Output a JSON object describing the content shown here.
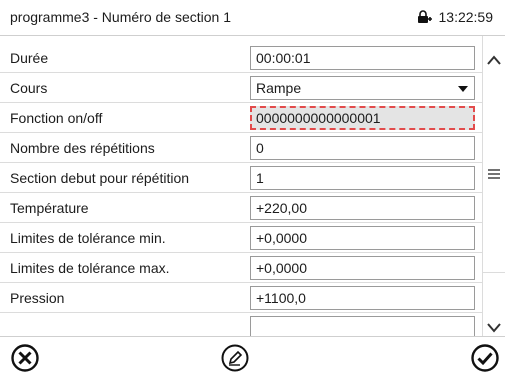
{
  "header": {
    "title": "programme3 - Numéro de section 1",
    "time": "13:22:59"
  },
  "rows": [
    {
      "label": "Durée",
      "value": "00:00:01"
    },
    {
      "label": "Cours",
      "value": "Rampe"
    },
    {
      "label": "Fonction on/off",
      "value": "0000000000000001"
    },
    {
      "label": "Nombre des répétitions",
      "value": "0"
    },
    {
      "label": "Section debut pour répétition",
      "value": "1"
    },
    {
      "label": "Température",
      "value": "+220,00"
    },
    {
      "label": "Limites de tolérance min.",
      "value": "+0,0000"
    },
    {
      "label": "Limites de tolérance max.",
      "value": "+0,0000"
    },
    {
      "label": "Pression",
      "value": "+1100,0"
    },
    {
      "label": "",
      "value": ""
    }
  ],
  "icons": {
    "clock_lock": "lock-icon",
    "scroll_up": "chevron-up-icon",
    "scroll_down": "chevron-down-icon",
    "menu": "menu-icon",
    "cancel": "cancel-icon",
    "edit": "edit-icon",
    "confirm": "confirm-icon"
  },
  "colors": {
    "selected_border": "#e24b4b",
    "selected_bg": "#e4e4e4"
  }
}
